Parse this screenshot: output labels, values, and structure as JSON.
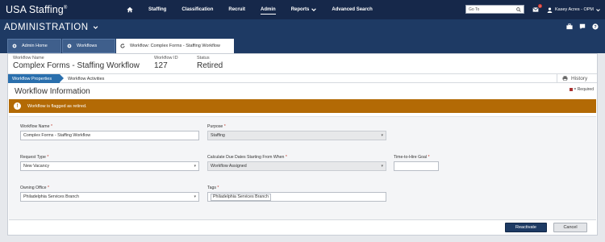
{
  "topnav": {
    "brand": "USA Staffing",
    "brand_mark": "®",
    "items": [
      {
        "label": "Staffing"
      },
      {
        "label": "Classification"
      },
      {
        "label": "Recruit"
      },
      {
        "label": "Admin"
      },
      {
        "label": "Reports"
      },
      {
        "label": "Advanced Search"
      }
    ],
    "goto_placeholder": "Go To",
    "notification_count": "2",
    "user_name": "Kasey Acres - OPM"
  },
  "adminbar": {
    "title": "ADMINISTRATION"
  },
  "tabs": [
    {
      "label": "Admin Home"
    },
    {
      "label": "Workflows"
    },
    {
      "label": "Workflow: Complex Forms - Staffing Workflow"
    }
  ],
  "workflow": {
    "name_label": "Workflow Name",
    "name_value": "Complex Forms - Staffing Workflow",
    "id_label": "Workflow ID",
    "id_value": "127",
    "status_label": "Status",
    "status_value": "Retired"
  },
  "subnav": {
    "properties": "Workflow Properties",
    "activities": "Workflow Activities",
    "history": "History"
  },
  "section": {
    "title": "Workflow Information",
    "required_note": "= Required"
  },
  "alert": {
    "icon": "!",
    "text": "Workflow is flagged as retired."
  },
  "form": {
    "workflow_name": {
      "label": "Workflow Name",
      "value": "Complex Forms - Staffing Workflow"
    },
    "purpose": {
      "label": "Purpose",
      "value": "Staffing"
    },
    "request_type": {
      "label": "Request Type",
      "value": "New Vacancy"
    },
    "due_dates": {
      "label": "Calculate Due Dates Starting From When",
      "value": "Workflow Assigned"
    },
    "time_to_hire": {
      "label": "Time-to-Hire Goal",
      "value": ""
    },
    "owning_office": {
      "label": "Owning Office",
      "value": "Philadelphia Services Branch"
    },
    "tags": {
      "label": "Tags",
      "value": "Philadelphia Services Branch"
    }
  },
  "footer": {
    "reactivate": "Reactivate",
    "cancel": "Cancel"
  },
  "colors": {
    "nav_bg": "#16284a",
    "admin_bg": "#1e3a64",
    "alert_bg": "#b36a05",
    "subtab_active": "#2a6fad",
    "primary_button": "#1d3a63"
  }
}
